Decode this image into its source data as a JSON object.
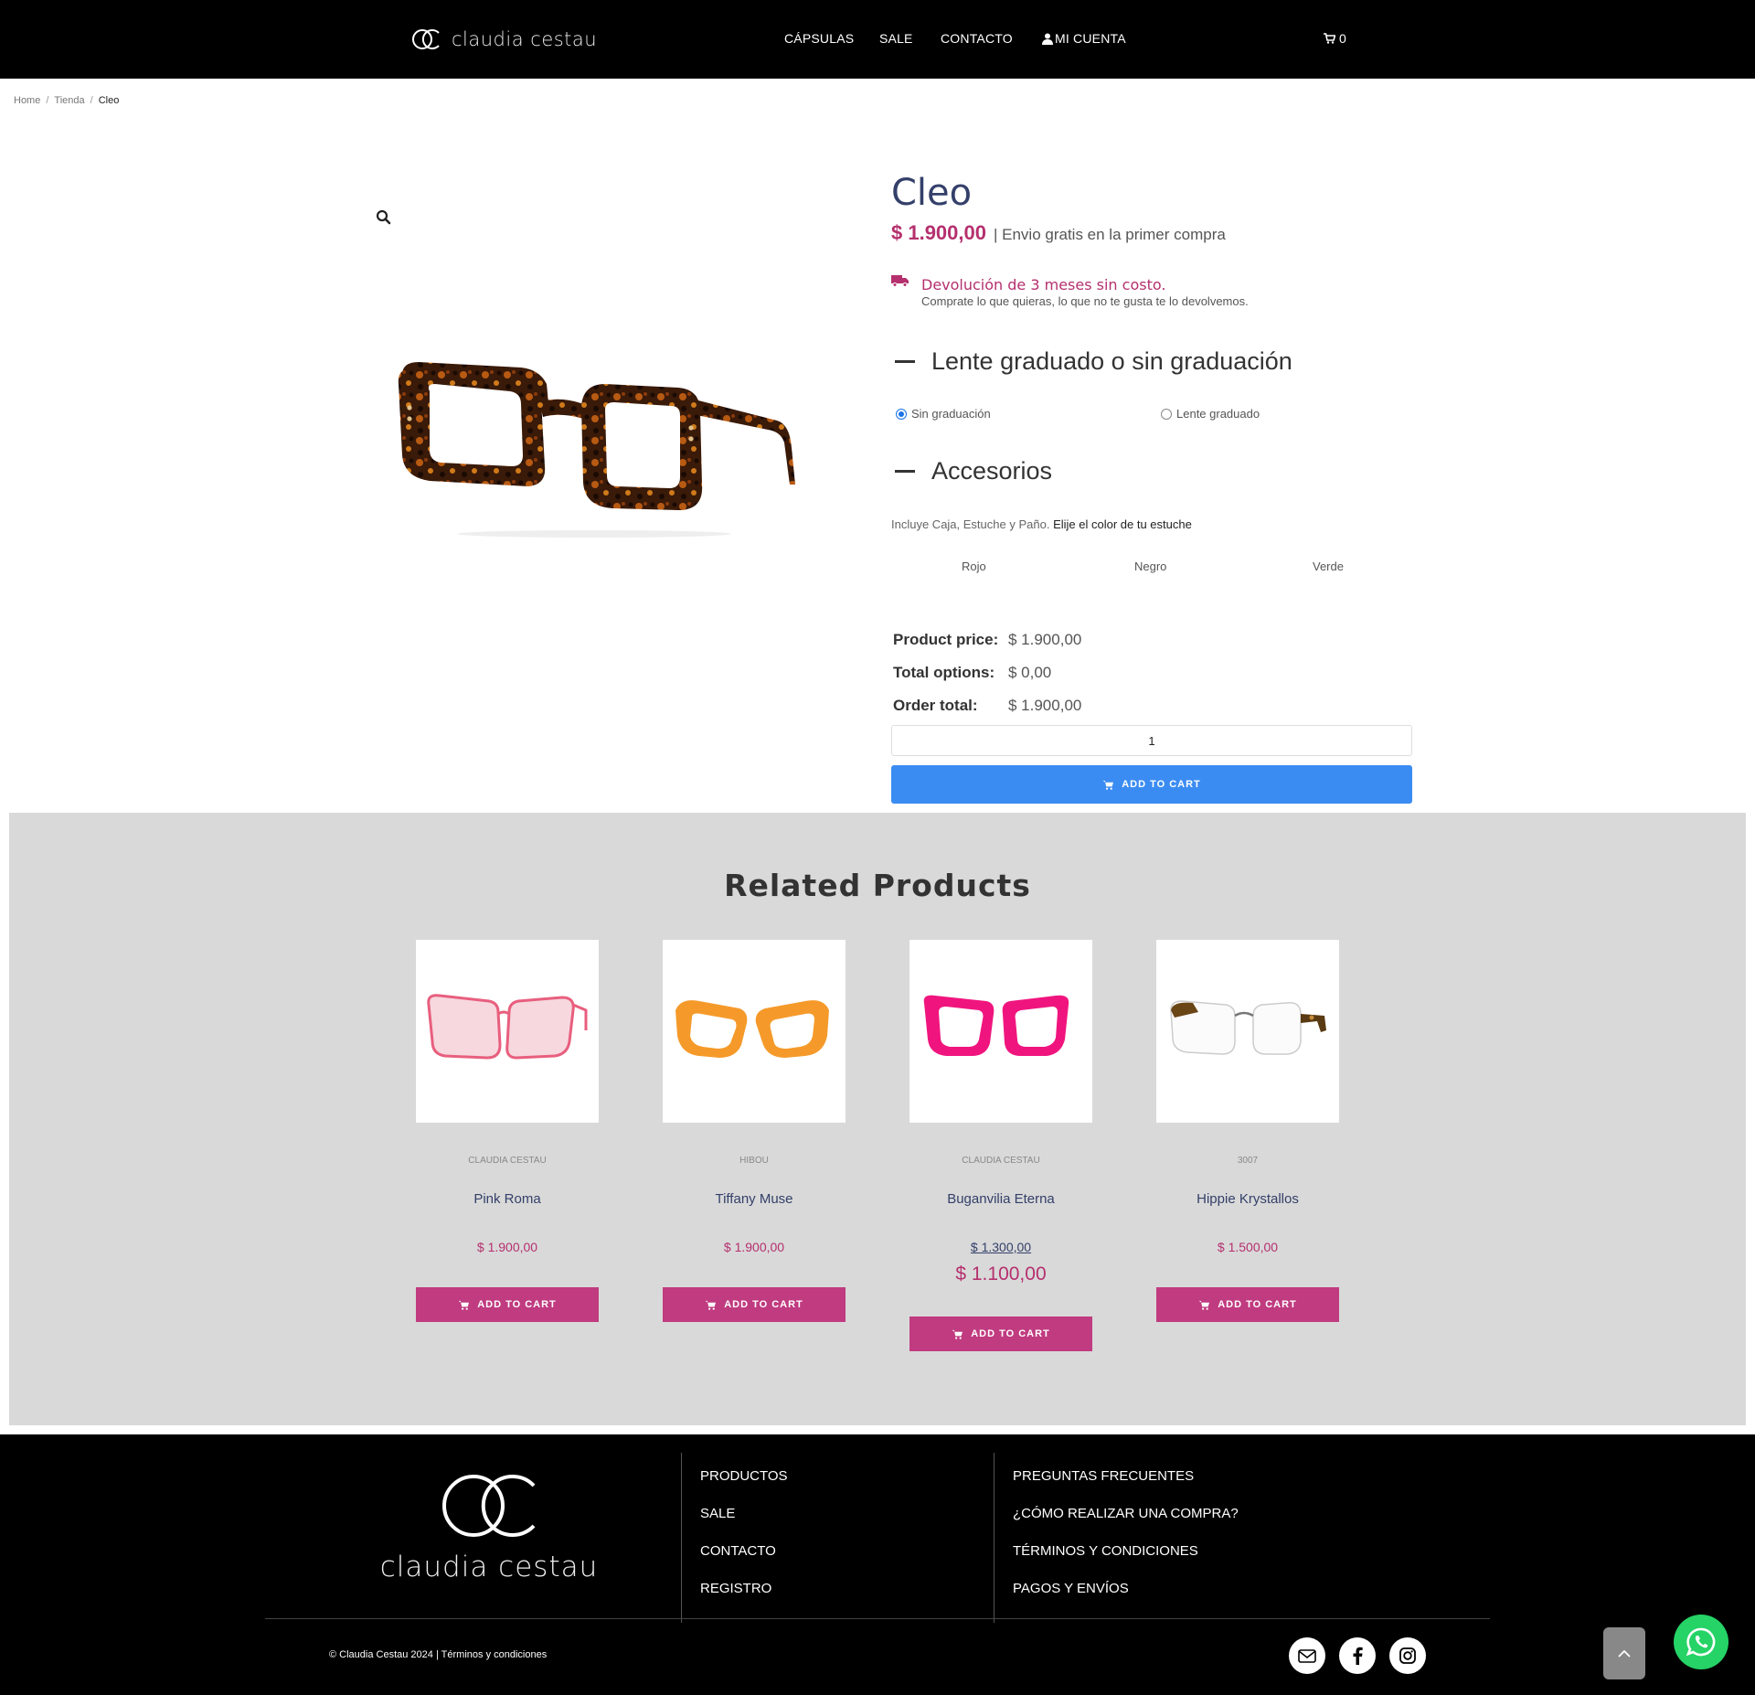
{
  "header": {
    "brand": "claudia cestau",
    "nav": [
      "CÁPSULAS",
      "SALE",
      "CONTACTO",
      "MI CUENTA"
    ],
    "cart_count": "0"
  },
  "breadcrumb": [
    "Home",
    "Tienda",
    "Cleo"
  ],
  "product": {
    "title": "Cleo",
    "price": "$ 1.900,00",
    "price_note": "| Envio gratis en la primer compra",
    "return_title": "Devolución de 3 meses sin costo.",
    "return_sub": "Comprate lo que quieras, lo que no te gusta te lo devolvemos.",
    "lens_heading": "Lente graduado o sin graduación",
    "lens_options": [
      "Sin graduación",
      "Lente graduado"
    ],
    "lens_selected": "Sin graduación",
    "accessories_heading": "Accesorios",
    "accessories_note": "Incluye Caja, Estuche y Paño.",
    "accessories_choose": "Elije el color de tu estuche",
    "case_colors": [
      "Rojo",
      "Negro",
      "Verde"
    ],
    "totals": [
      {
        "label": "Product price:",
        "value": "$ 1.900,00"
      },
      {
        "label": "Total options:",
        "value": "$ 0,00"
      },
      {
        "label": "Order total:",
        "value": "$ 1.900,00"
      }
    ],
    "quantity": "1",
    "add_to_cart": "ADD TO CART"
  },
  "related": {
    "title": "Related Products",
    "items": [
      {
        "brand": "CLAUDIA CESTAU",
        "name": "Pink Roma",
        "price": "$ 1.900,00",
        "button": "ADD TO CART",
        "color": "#e85f7e"
      },
      {
        "brand": "HIBOU",
        "name": "Tiffany Muse",
        "price": "$ 1.900,00",
        "button": "ADD TO CART",
        "color": "#f08a0e"
      },
      {
        "brand": "CLAUDIA CESTAU",
        "name": "Buganvilia Eterna",
        "old_price": "$ 1.300,00",
        "new_price": "$ 1.100,00",
        "button": "ADD TO CART",
        "color": "#f0157e"
      },
      {
        "brand": "3007",
        "name": "Hippie Krystallos",
        "price": "$ 1.500,00",
        "button": "ADD TO CART",
        "color": "#5a3a12"
      }
    ]
  },
  "footer": {
    "brand": "claudia cestau",
    "col1": [
      "PRODUCTOS",
      "SALE",
      "CONTACTO",
      "REGISTRO"
    ],
    "col2": [
      "PREGUNTAS FRECUENTES",
      "¿CÓMO REALIZAR UNA COMPRA?",
      "TÉRMINOS Y CONDICIONES",
      "PAGOS Y ENVÍOS"
    ],
    "copyright": "© Claudia Cestau 2024 | Términos y condiciones",
    "social": [
      "mail-icon",
      "facebook-icon",
      "instagram-icon"
    ]
  },
  "colors": {
    "accent": "#b5306e",
    "title": "#34406a",
    "cta": "#3b8cf2",
    "button": "#c03b80"
  }
}
